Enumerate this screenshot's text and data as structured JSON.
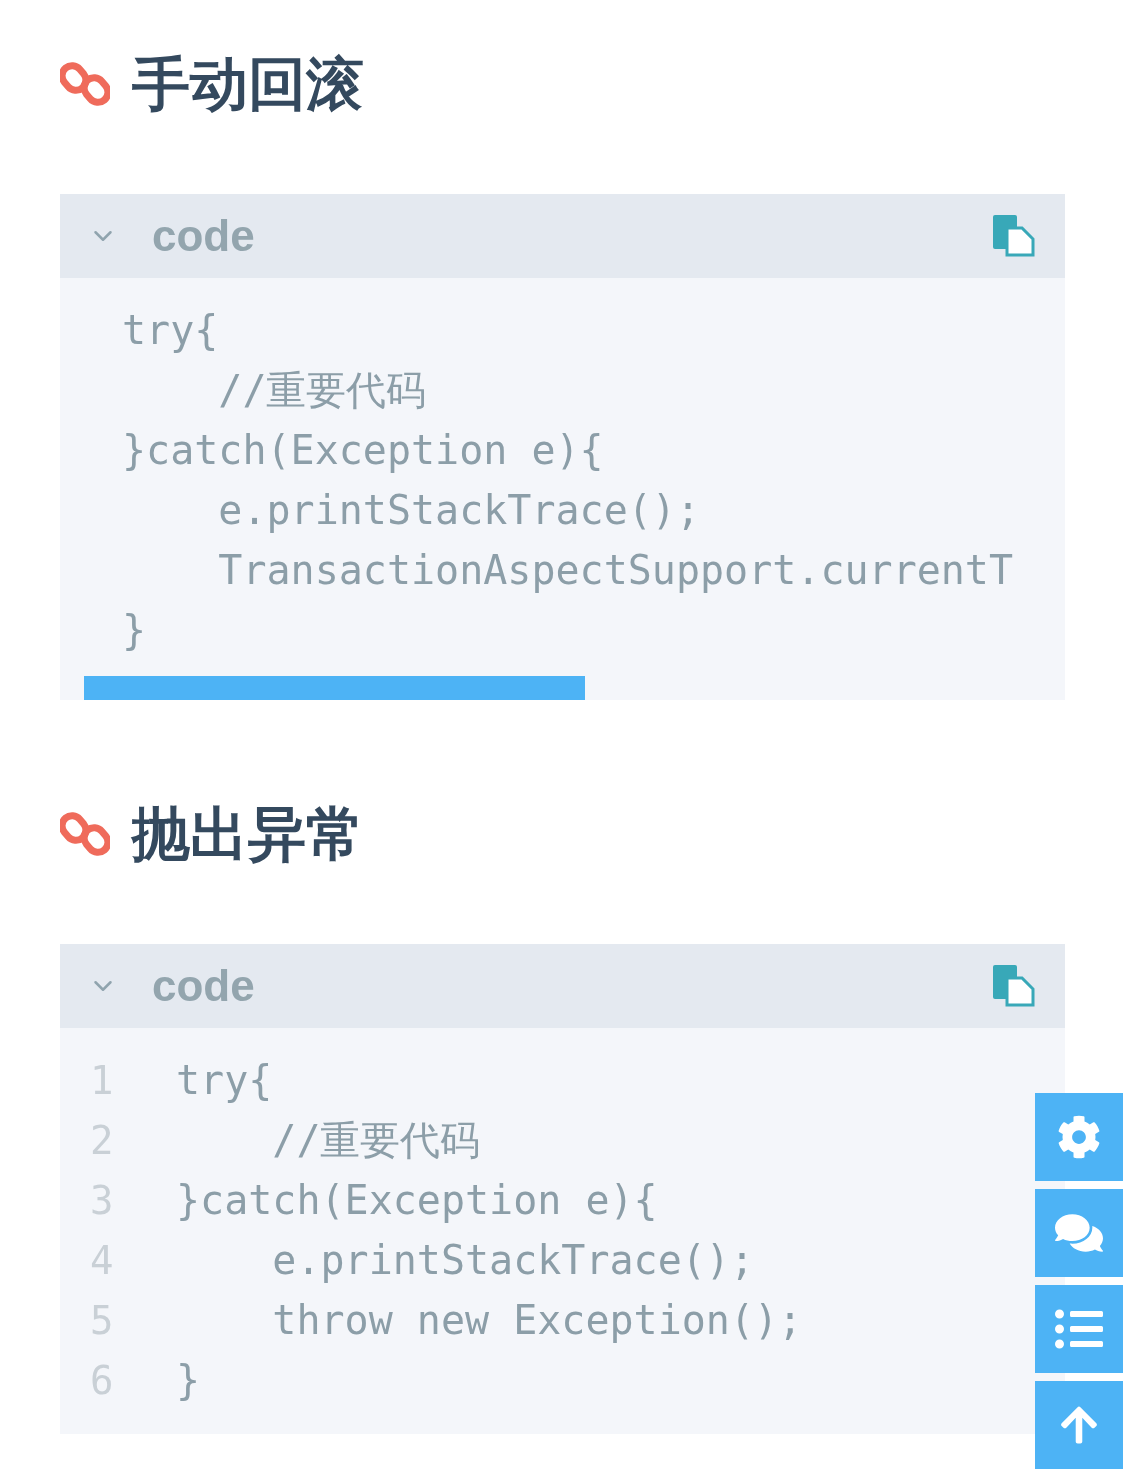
{
  "sections": [
    {
      "heading": "手动回滚",
      "code_block": {
        "label": "code",
        "expanded": true,
        "scrollable": true,
        "lines": [
          {
            "text": "try{"
          },
          {
            "text": "    //重要代码"
          },
          {
            "text": "}catch(Exception e){"
          },
          {
            "text": "    e.printStackTrace();"
          },
          {
            "text": "    TransactionAspectSupport.currentT"
          },
          {
            "text": "}"
          }
        ]
      }
    },
    {
      "heading": "抛出异常",
      "code_block": {
        "label": "code",
        "expanded": true,
        "scrollable": false,
        "lines": [
          {
            "number": "1",
            "text": "try{"
          },
          {
            "number": "2",
            "text": "    //重要代码"
          },
          {
            "number": "3",
            "text": "}catch(Exception e){"
          },
          {
            "number": "4",
            "text": "    e.printStackTrace();"
          },
          {
            "number": "5",
            "text": "    throw new Exception();"
          },
          {
            "number": "6",
            "text": "}"
          }
        ]
      }
    }
  ]
}
